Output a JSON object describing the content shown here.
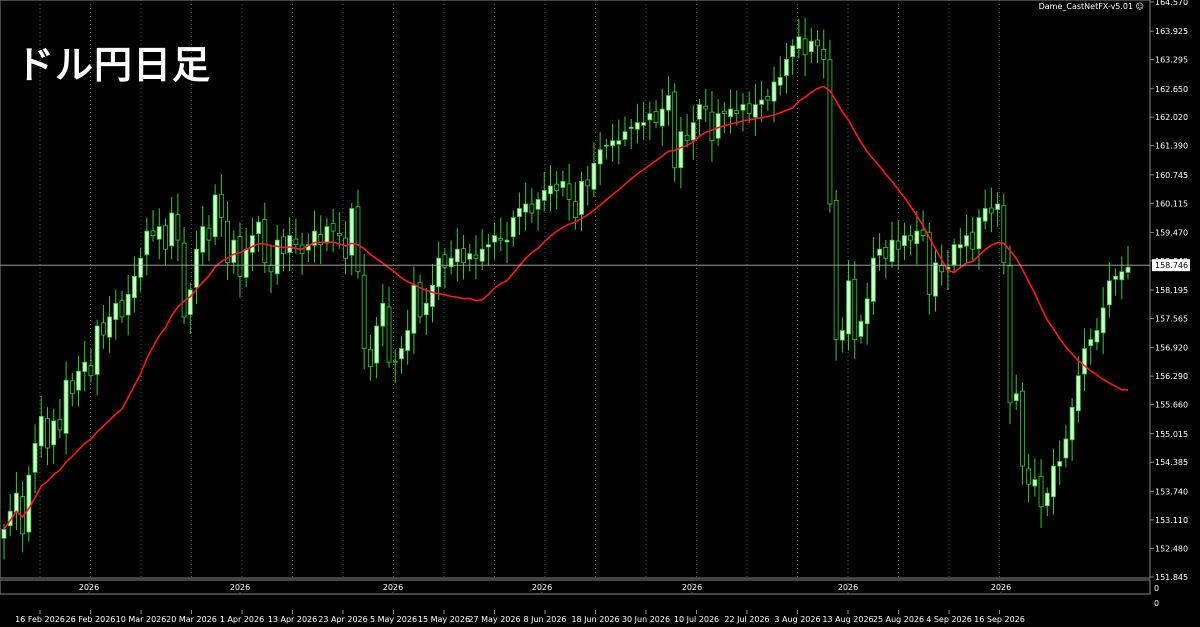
{
  "title": "ドル円日足",
  "indicator_label": "Dame_CastNetFX-v5.01",
  "smiley": "☺",
  "current_price": "158.746",
  "subwindow_value": "0",
  "colors": {
    "background": "#000000",
    "candle_bull": "#ccffcc",
    "candle_bear": "#000000",
    "candle_outline": "#33cc33",
    "wick": "#33cc33",
    "ma": "#ff1a1a",
    "grid": "#555555",
    "text": "#ffffff",
    "current_line": "#b0b0b0"
  },
  "chart_data": {
    "type": "candlestick",
    "ylim": [
      151.845,
      164.57
    ],
    "yticks": [
      "164.570",
      "163.925",
      "163.295",
      "162.650",
      "162.020",
      "161.390",
      "160.745",
      "160.115",
      "159.470",
      "158.840",
      "158.195",
      "157.565",
      "156.920",
      "156.290",
      "155.660",
      "155.015",
      "154.385",
      "153.740",
      "153.110",
      "152.480",
      "151.845"
    ],
    "grid": "vertical dotted",
    "xticks": [
      "16 Feb 2026",
      "26 Feb 2026",
      "10 Mar 2026",
      "20 Mar 2026",
      "1 Apr 2026",
      "13 Apr 2026",
      "23 Apr 2026",
      "5 May 2026",
      "15 May 2026",
      "27 May 2026",
      "8 Jun 2026",
      "18 Jun 2026",
      "30 Jun 2026",
      "10 Jul 2026",
      "22 Jul 2026",
      "3 Aug 2026",
      "13 Aug 2026",
      "25 Aug 2026",
      "4 Sep 2026",
      "16 Sep 2026"
    ],
    "subwindow_label": "2026",
    "series": [
      {
        "close": [
          152.9,
          153.3,
          153.7,
          152.8,
          154.1,
          154.8,
          155.4,
          154.7,
          155.3,
          155.1,
          156.2,
          155.9,
          156.4,
          156.6,
          156.3,
          157.4,
          157.2,
          157.6,
          157.9,
          157.6,
          158.1,
          158.5,
          158.9,
          159.5,
          159.4,
          159.6,
          159.1,
          159.9,
          159.3,
          157.6,
          158.2,
          159.1,
          159.6,
          159.3,
          160.3,
          159.8,
          158.8,
          159.3,
          158.5,
          159.1,
          159.4,
          159.7,
          158.8,
          158.6,
          159.3,
          159.0,
          159.4,
          159.2,
          159.0,
          159.2,
          159.5,
          159.2,
          159.6,
          159.5,
          159.4,
          158.9,
          160.0,
          158.6,
          156.9,
          156.5,
          157.4,
          157.9,
          156.6,
          156.6,
          156.9,
          157.3,
          158.3,
          157.6,
          157.9,
          158.3,
          158.9,
          158.7,
          158.9,
          159.1,
          158.8,
          159.0,
          158.9,
          159.1,
          159.2,
          159.4,
          159.3,
          159.3,
          159.8,
          160.0,
          160.1,
          159.9,
          160.2,
          160.4,
          160.5,
          160.4,
          160.6,
          160.2,
          159.8,
          160.6,
          160.5,
          161.0,
          161.3,
          161.4,
          161.5,
          161.5,
          161.7,
          161.8,
          161.9,
          161.9,
          162.1,
          161.9,
          162.2,
          162.5,
          160.9,
          161.7,
          161.5,
          161.9,
          162.3,
          162.2,
          161.5,
          162.1,
          162.1,
          162.2,
          162.1,
          162.3,
          162.1,
          162.3,
          162.4,
          162.4,
          162.8,
          162.9,
          163.3,
          163.6,
          163.8,
          163.4,
          163.7,
          163.6,
          163.3,
          160.1,
          157.1,
          157.3,
          158.4,
          157.1,
          157.5,
          158.0,
          158.9,
          159.1,
          158.9,
          159.3,
          159.1,
          159.4,
          159.3,
          159.5,
          159.4,
          158.1,
          158.8,
          158.6,
          158.7,
          159.2,
          159.2,
          159.4,
          159.1,
          159.8,
          160.0,
          159.9,
          160.1,
          158.8,
          155.7,
          155.9,
          154.3,
          153.9,
          154.0,
          153.4,
          153.7,
          154.3,
          154.4,
          154.9,
          155.6,
          156.3,
          156.9,
          157.1,
          157.3,
          157.8,
          158.4,
          158.5,
          158.6,
          158.7
        ]
      }
    ]
  }
}
